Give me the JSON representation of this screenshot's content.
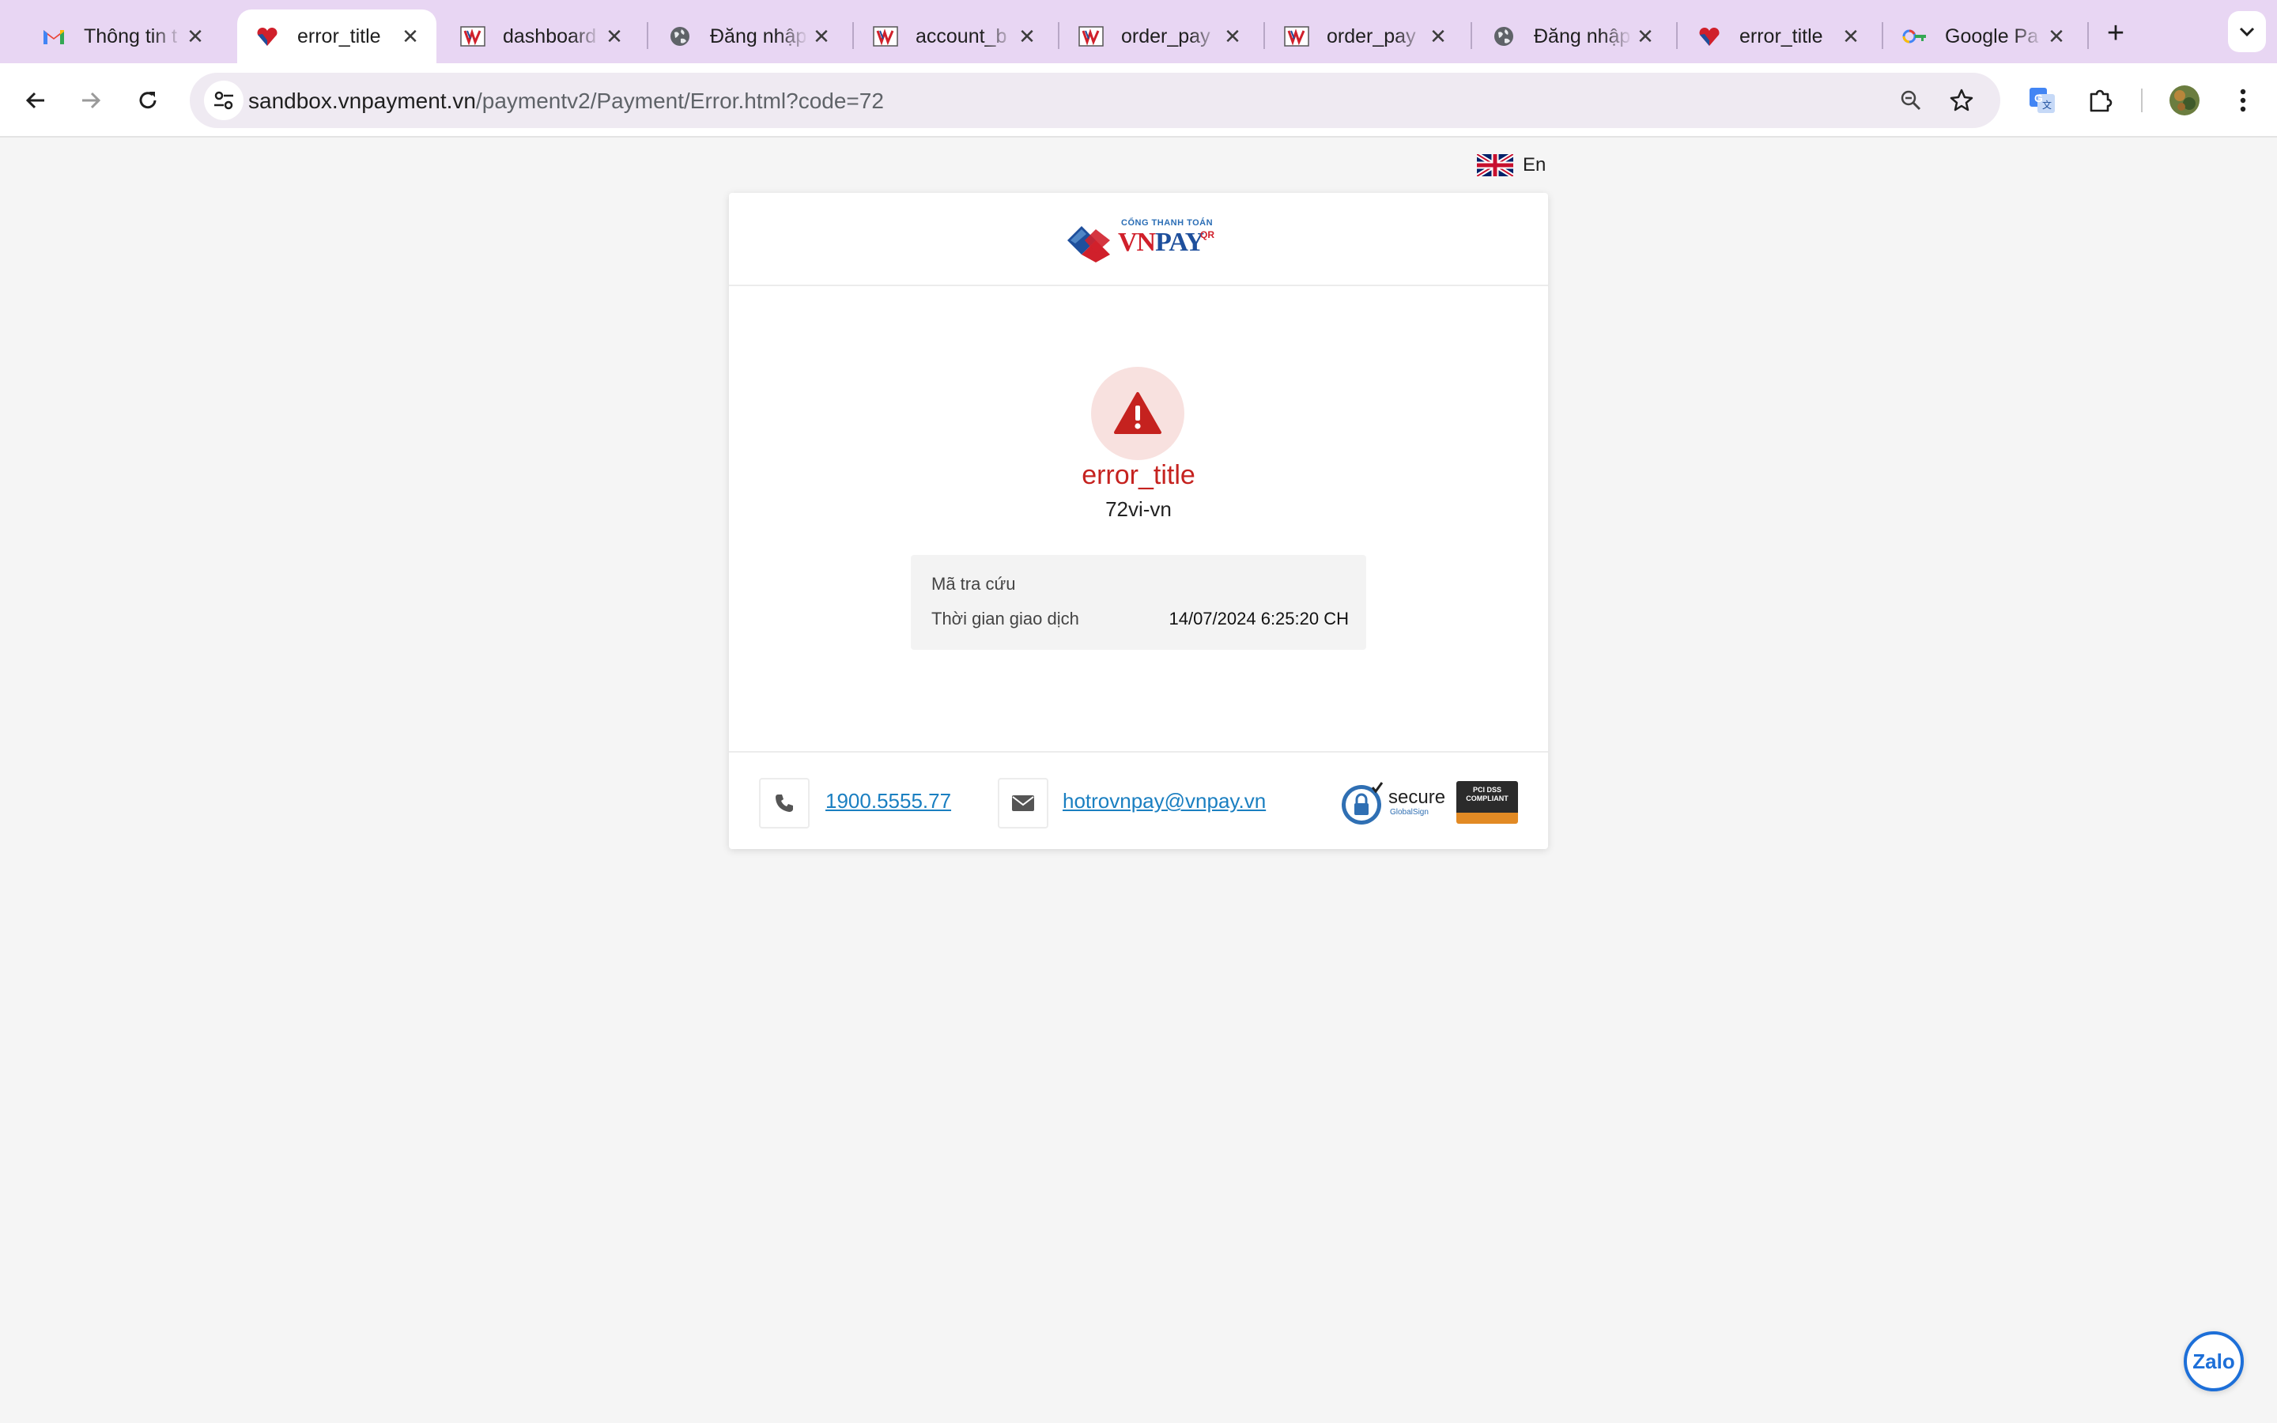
{
  "browser": {
    "tabs": [
      {
        "title": "Thông tin t",
        "icon": "gmail-icon"
      },
      {
        "title": "error_title",
        "icon": "vnpay-icon"
      },
      {
        "title": "dashboard",
        "icon": "vnpay-icon"
      },
      {
        "title": "Đăng nhập",
        "icon": "globe-icon"
      },
      {
        "title": "account_b",
        "icon": "vnpay-icon"
      },
      {
        "title": "order_pay",
        "icon": "vnpay-icon"
      },
      {
        "title": "order_pay",
        "icon": "vnpay-icon"
      },
      {
        "title": "Đăng nhập",
        "icon": "globe-icon"
      },
      {
        "title": "error_title",
        "icon": "vnpay-icon"
      },
      {
        "title": "Google Pa",
        "icon": "google-icon"
      }
    ],
    "active_tab": 1,
    "url_host": "sandbox.vnpayment.vn",
    "url_path": "/paymentv2/Payment/Error.html?code=72"
  },
  "page": {
    "language": "En",
    "logo": {
      "small": "CỔNG THANH TOÁN",
      "brand_vn": "VN",
      "brand_pay": "PAY",
      "brand_qr": "QR"
    },
    "error_title": "error_title",
    "error_code": "72vi-vn",
    "info": {
      "lookup_label": "Mã tra cứu",
      "lookup_value": "",
      "time_label": "Thời gian giao dịch",
      "time_value": "14/07/2024 6:25:20 CH"
    },
    "footer": {
      "phone": "1900.5555.77",
      "email": "hotrovnpay@vnpay.vn",
      "secure_label": "secure",
      "secure_sub": "GlobalSign",
      "pci_label": "PCI DSS COMPLIANT"
    },
    "zalo": "Zalo"
  },
  "colors": {
    "tabbar": "#e8d6f3",
    "error": "#c5221f",
    "link": "#1a7fc1",
    "vnpay_red": "#d0202b",
    "vnpay_blue": "#1e4f9c"
  }
}
